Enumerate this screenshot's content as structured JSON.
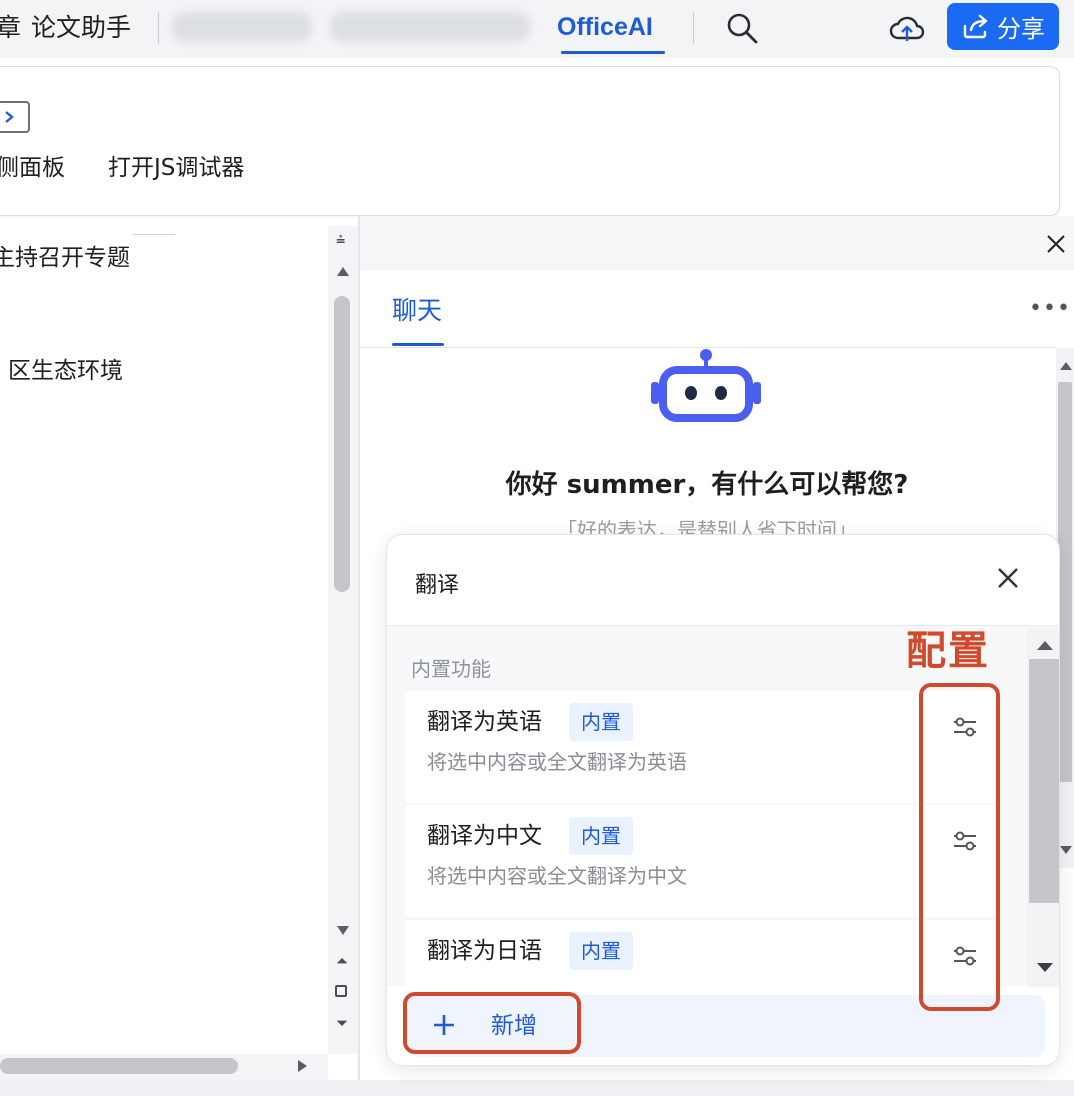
{
  "menubar": {
    "partial_item": "章",
    "paper_assistant": "论文助手",
    "officeai": "OfficeAI",
    "share_label": "分享"
  },
  "ribbon": {
    "side_panel_label": "侧面板",
    "js_debugger_label": "打开JS调试器"
  },
  "document": {
    "line1": "主持召开专题",
    "line2": "区生态环境"
  },
  "chat": {
    "tab_label": "聊天",
    "greeting": "你好 summer，有什么可以帮您?",
    "slogan": "「好的表达，是替别人省下时间」"
  },
  "popup": {
    "title": "翻译",
    "section_label": "内置功能",
    "items": [
      {
        "title": "翻译为英语",
        "badge": "内置",
        "desc": "将选中内容或全文翻译为英语"
      },
      {
        "title": "翻译为中文",
        "badge": "内置",
        "desc": "将选中内容或全文翻译为中文"
      },
      {
        "title": "翻译为日语",
        "badge": "内置",
        "desc": ""
      }
    ],
    "add_label": "新增"
  },
  "annotation": {
    "label": "配置",
    "color": "#d04a2e"
  },
  "colors": {
    "accent": "#1e5bd8",
    "share_button": "#1a6af3",
    "badge_bg": "#eaf1ff"
  },
  "icons": [
    "search-icon",
    "cloud-upload-icon",
    "share-icon",
    "close-icon",
    "robot-icon",
    "config-icon",
    "plus-icon",
    "more-icon"
  ]
}
